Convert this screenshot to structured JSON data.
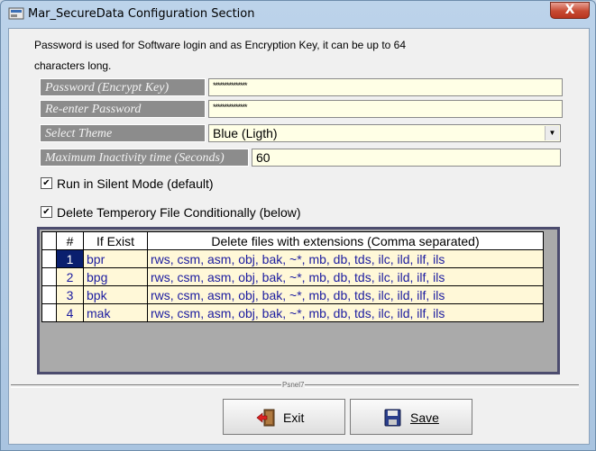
{
  "window": {
    "title": "Mar_SecureData Configuration Section",
    "close_label": "X"
  },
  "intro": {
    "line1": "Password is used for Software login and as Encryption Key,  it can be up to 64",
    "line2": "characters long."
  },
  "fields": {
    "password_label": "Password (Encrypt Key)",
    "password_value": "***************",
    "reenter_label": "Re-enter Password",
    "reenter_value": "***************",
    "theme_label": "Select Theme",
    "theme_value": "Blue (Ligth)",
    "inactivity_label": "Maximum Inactivity time (Seconds)",
    "inactivity_value": "60"
  },
  "checkboxes": {
    "silent_mode": {
      "label": "Run in Silent Mode (default)",
      "checked": true,
      "mark": "✔"
    },
    "delete_temp": {
      "label": "Delete Temperory File Conditionally (below)",
      "checked": true,
      "mark": "✔"
    }
  },
  "grid": {
    "headers": [
      "#",
      "If Exist",
      "Delete files with extensions (Comma separated)"
    ],
    "rows": [
      {
        "num": "1",
        "if_exist": "bpr",
        "extensions": "rws, csm, asm, obj, bak, ~*, mb, db, tds, ilc, ild, ilf, ils"
      },
      {
        "num": "2",
        "if_exist": "bpg",
        "extensions": "rws, csm, asm, obj, bak, ~*, mb, db, tds, ilc, ild, ilf, ils"
      },
      {
        "num": "3",
        "if_exist": "bpk",
        "extensions": "rws, csm, asm, obj, bak, ~*, mb, db, tds, ilc, ild, ilf, ils"
      },
      {
        "num": "4",
        "if_exist": "mak",
        "extensions": "rws, csm, asm, obj, bak, ~*, mb, db, tds, ilc, ild, ilf, ils"
      }
    ]
  },
  "separator_caption": "Psnel7",
  "buttons": {
    "exit_label": "Exit",
    "save_label": "Save"
  },
  "icons": {
    "app": "app-icon",
    "exit": "exit-door-icon",
    "save": "floppy-disk-icon",
    "dropdown": "dropdown-arrow-icon"
  }
}
